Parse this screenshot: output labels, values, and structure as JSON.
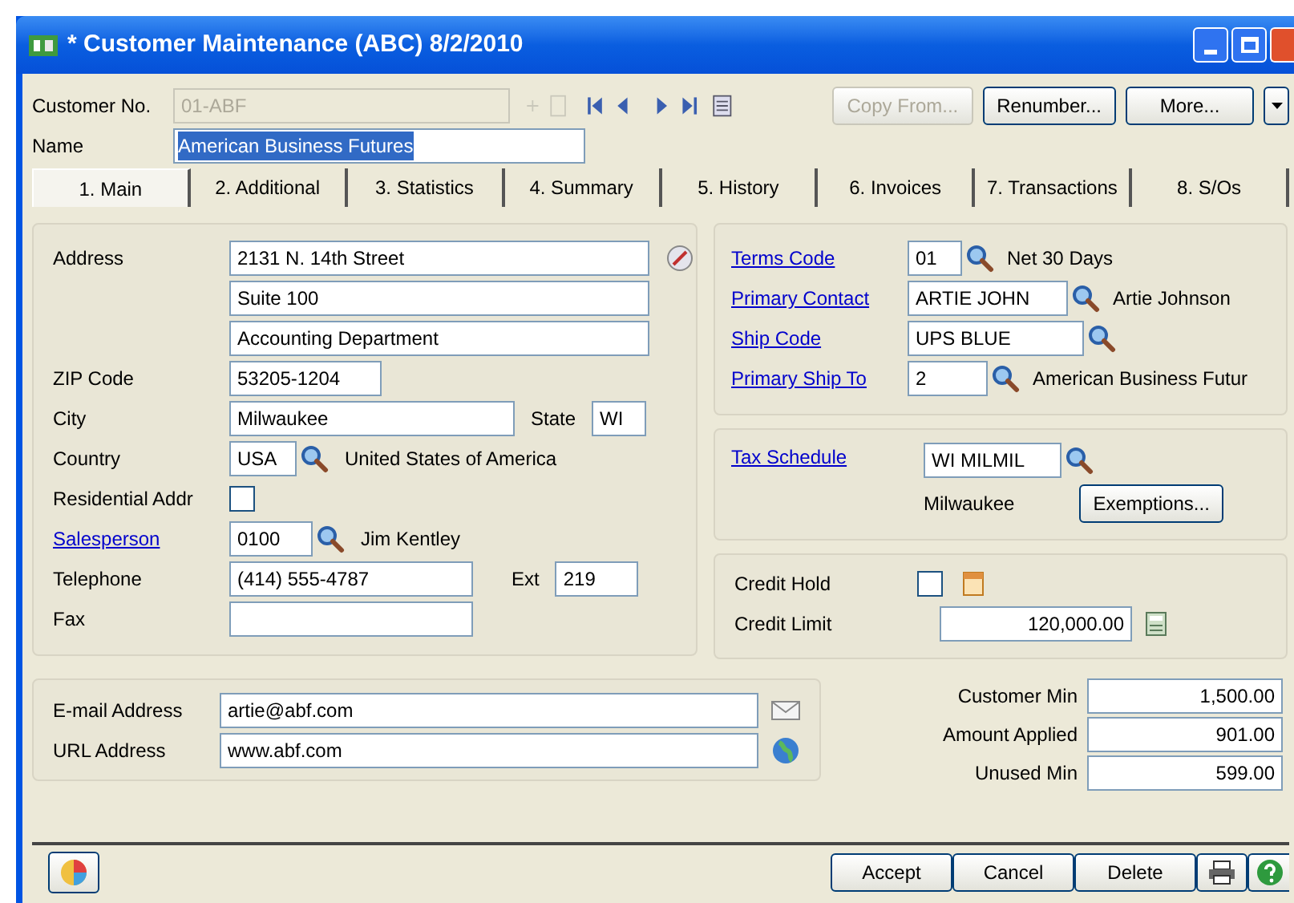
{
  "window": {
    "title": "* Customer Maintenance (ABC) 8/2/2010"
  },
  "header": {
    "customer_no": {
      "label": "Customer No.",
      "value": "01-ABF",
      "disabled": true
    },
    "name": {
      "label": "Name",
      "value": "American Business Futures",
      "selected": true
    },
    "buttons": [
      {
        "label": "Copy From...",
        "disabled": true
      },
      {
        "label": "Renumber...",
        "disabled": false
      },
      {
        "label": "More...",
        "disabled": false
      }
    ]
  },
  "tabs": [
    {
      "label": "1. Main",
      "selected": true
    },
    {
      "label": "2. Additional",
      "selected": false
    },
    {
      "label": "3. Statistics",
      "selected": false
    },
    {
      "label": "4. Summary",
      "selected": false
    },
    {
      "label": "5. History",
      "selected": false
    },
    {
      "label": "6. Invoices",
      "selected": false
    },
    {
      "label": "7. Transactions",
      "selected": false
    },
    {
      "label": "8. S/Os",
      "selected": false
    }
  ],
  "address": {
    "label": "Address",
    "lines": [
      "2131 N. 14th Street",
      "Suite 100",
      "Accounting Department"
    ],
    "zip": {
      "label": "ZIP Code",
      "value": "53205-1204"
    },
    "city": {
      "label": "City",
      "value": "Milwaukee"
    },
    "state": {
      "label": "State",
      "value": "WI"
    },
    "country": {
      "label": "Country",
      "value": "USA",
      "description": "United States of America"
    },
    "residential": {
      "label": "Residential Addr",
      "checked": false
    },
    "salesperson": {
      "label": "Salesperson",
      "value": "0100",
      "description": "Jim Kentley"
    },
    "telephone": {
      "label": "Telephone",
      "value": "(414) 555-4787"
    },
    "ext": {
      "label": "Ext",
      "value": "219"
    },
    "fax": {
      "label": "Fax"
    }
  },
  "terms": [
    {
      "label": "Terms Code",
      "value": "01",
      "description": "Net 30 Days"
    },
    {
      "label": "Primary Contact",
      "value": "ARTIE JOHN",
      "description": "Artie Johnson"
    },
    {
      "label": "Ship Code",
      "value": "UPS BLUE"
    },
    {
      "label": "Primary Ship To",
      "value": "2",
      "description": "American Business Futur"
    }
  ],
  "tax": {
    "label": "Tax Schedule",
    "value": "WI MILMIL",
    "description": "Milwaukee",
    "button": "Exemptions..."
  },
  "credit": {
    "hold": {
      "label": "Credit Hold",
      "checked": false
    },
    "limit": {
      "label": "Credit Limit",
      "value": "120,000.00"
    }
  },
  "contact": {
    "email": {
      "label": "E-mail Address",
      "value": "artie@abf.com"
    },
    "url": {
      "label": "URL Address",
      "value": "www.abf.com"
    }
  },
  "minimums": [
    {
      "label": "Customer Min",
      "value": "1,500.00"
    },
    {
      "label": "Amount Applied",
      "value": "901.00"
    },
    {
      "label": "Unused Min",
      "value": "599.00"
    }
  ],
  "footer": {
    "buttons": [
      "Accept",
      "Cancel",
      "Delete"
    ]
  }
}
